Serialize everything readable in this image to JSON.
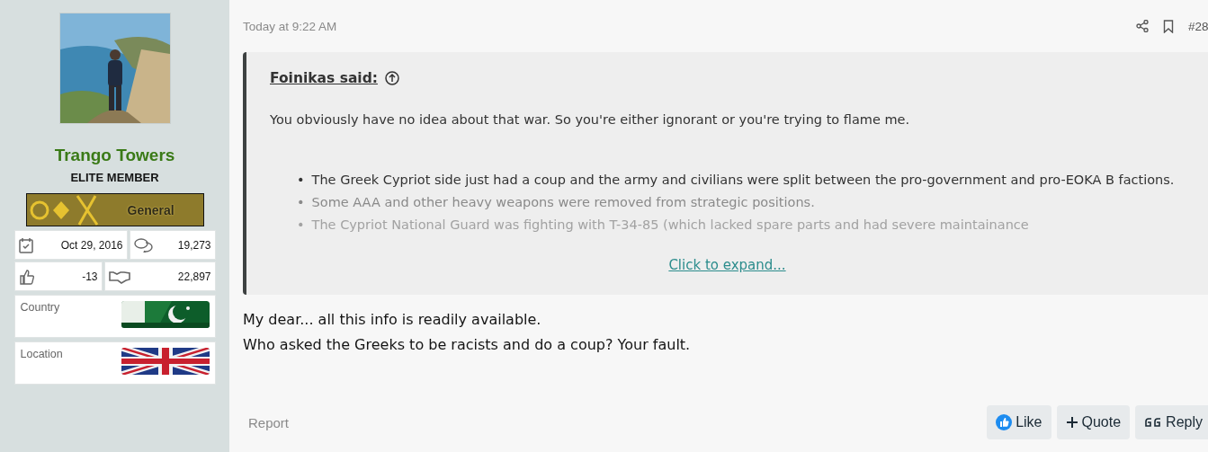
{
  "user": {
    "name": "Trango Towers",
    "title": "ELITE MEMBER",
    "rank": "General",
    "joined": "Oct 29, 2016",
    "messages": "19,273",
    "reactions": "-13",
    "points": "22,897",
    "fields": [
      {
        "label": "Country",
        "kind": "pk"
      },
      {
        "label": "Location",
        "kind": "uk"
      }
    ]
  },
  "post": {
    "time": "Today at 9:22 AM",
    "number": "#28",
    "quote": {
      "author": "Foinikas said:",
      "text": "You obviously have no idea about that war. So you're either ignorant or you're trying to flame me.",
      "bullets": [
        {
          "marker": "•",
          "text": "The Greek Cypriot side just had a coup and the army and civilians were split between the pro-government and pro-EOKA B factions."
        },
        {
          "marker": "•",
          "text": "Some AAA and other heavy weapons were removed from strategic positions."
        },
        {
          "marker": "•",
          "text": "The Cypriot National Guard was fighting with T-34-85 (which lacked spare parts and had severe maintainance"
        }
      ],
      "expand": "Click to expand..."
    },
    "body": [
      "My dear... all this info is readily available.",
      "Who asked the Greeks to be racists and do a coup? Your fault."
    ],
    "report": "Report",
    "actions": [
      {
        "kind": "like",
        "label": "Like"
      },
      {
        "kind": "quote",
        "label": "Quote"
      },
      {
        "kind": "reply",
        "label": "Reply"
      }
    ]
  }
}
